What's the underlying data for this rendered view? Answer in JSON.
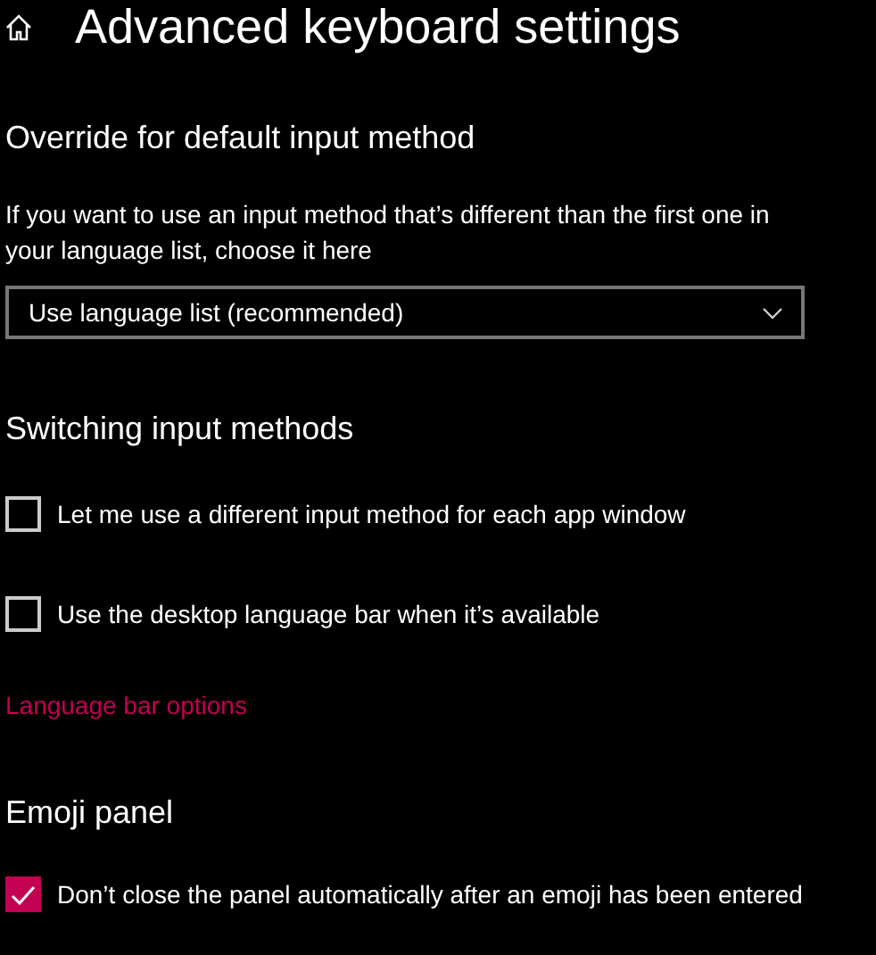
{
  "page": {
    "title": "Advanced keyboard settings"
  },
  "sections": [
    {
      "heading": "Override for default input method",
      "items": [
        {
          "kind": "text",
          "text": "If you want to use an input method that’s different than the first one in your language list, choose it here"
        },
        {
          "kind": "dropdown",
          "value": "Use language list (recommended)"
        }
      ]
    },
    {
      "heading": "Switching input methods",
      "items": [
        {
          "kind": "checkbox",
          "label": "Let me use a different input method for each app window",
          "checked": false
        },
        {
          "kind": "checkbox",
          "label": "Use the desktop language bar when it’s available",
          "checked": false
        },
        {
          "kind": "link",
          "text": "Language bar options"
        }
      ]
    },
    {
      "heading": "Emoji panel",
      "items": [
        {
          "kind": "checkbox",
          "label": "Don’t close the panel automatically after an emoji has been entered",
          "checked": true
        }
      ]
    }
  ]
}
